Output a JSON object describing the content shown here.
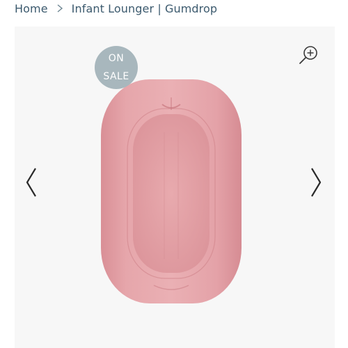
{
  "breadcrumb": {
    "home": "Home",
    "current": "Infant Lounger | Gumdrop"
  },
  "gallery": {
    "badge_line1": "ON",
    "badge_line2": "SALE",
    "badge_color": "#a8b7bd",
    "product_color": "#e3a3a8",
    "zoom_icon": "zoom-in-icon",
    "prev_icon": "chevron-left-icon",
    "next_icon": "chevron-right-icon"
  }
}
